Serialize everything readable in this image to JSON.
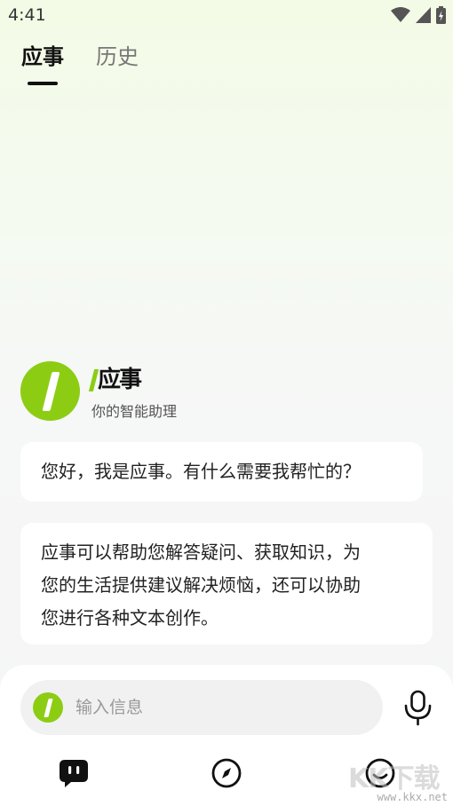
{
  "status_bar": {
    "time": "4:41",
    "icons": [
      "wifi-icon",
      "signal-icon",
      "battery-icon"
    ]
  },
  "tabs": [
    {
      "label": "应事",
      "active": true
    },
    {
      "label": "历史",
      "active": false
    }
  ],
  "assistant": {
    "name": "应事",
    "subtitle": "你的智能助理",
    "brand_color": "#8ccd14"
  },
  "messages": [
    {
      "text": "您好，我是应事。有什么需要我帮忙的？"
    },
    {
      "lines": [
        "应事可以帮助您解答疑问、获取知识，为",
        "您的生活提供建议解决烦恼，还可以协助",
        "您进行各种文本创作。"
      ]
    }
  ],
  "composer": {
    "placeholder": "输入信息",
    "mic_icon": "microphone-icon"
  },
  "bottom_nav": [
    {
      "icon": "chat-bubble-icon",
      "active": true
    },
    {
      "icon": "compass-icon",
      "active": false
    },
    {
      "icon": "smiley-profile-icon",
      "active": false
    }
  ],
  "watermark": {
    "logo": "KK下载",
    "url": "www.kkx.net"
  }
}
